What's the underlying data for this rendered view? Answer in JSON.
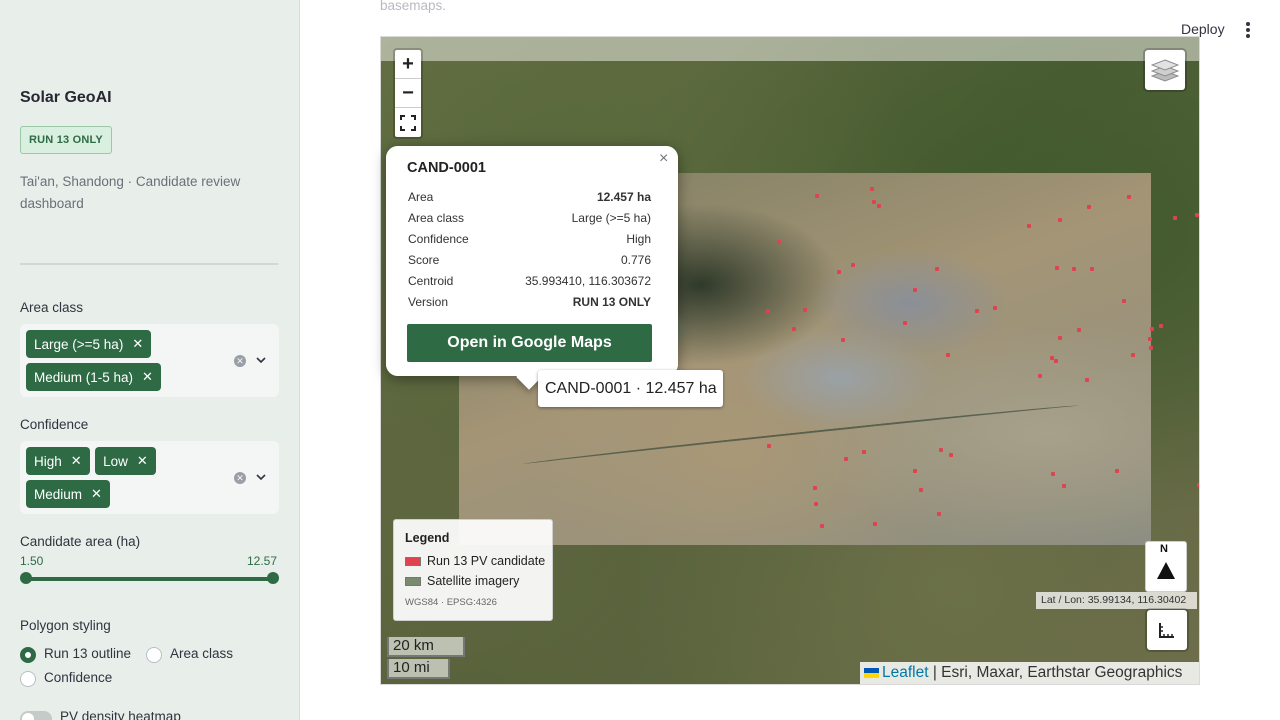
{
  "sidebar": {
    "title": "Solar GeoAI",
    "badge": "RUN 13 ONLY",
    "subtitle": "Tai'an, Shandong · Candidate review dashboard",
    "area_class": {
      "label": "Area class",
      "chips": [
        "Large (>=5 ha)",
        "Medium (1-5 ha)"
      ]
    },
    "confidence": {
      "label": "Confidence",
      "chips": [
        "High",
        "Low",
        "Medium"
      ]
    },
    "candidate_area": {
      "label": "Candidate area (ha)",
      "min": "1.50",
      "max": "12.57"
    },
    "polygon_styling": {
      "label": "Polygon styling",
      "options": [
        "Run 13 outline",
        "Area class",
        "Confidence"
      ],
      "selected": "Run 13 outline"
    },
    "heatmap_toggle": {
      "label": "PV density heatmap",
      "enabled": false
    }
  },
  "header": {
    "top_text": "basemaps.",
    "deploy_label": "Deploy"
  },
  "map": {
    "zoom_in": "+",
    "zoom_out": "−",
    "popup": {
      "title": "CAND-0001",
      "close": "×",
      "rows": [
        {
          "label": "Area",
          "value": "12.457 ha"
        },
        {
          "label": "Area class",
          "value": "Large (>=5 ha)"
        },
        {
          "label": "Confidence",
          "value": "High"
        },
        {
          "label": "Score",
          "value": "0.776"
        },
        {
          "label": "Centroid",
          "value": "35.993410, 116.303672"
        },
        {
          "label": "Version",
          "value": "RUN 13 ONLY"
        }
      ],
      "button": "Open in Google Maps"
    },
    "tooltip": "CAND-0001 · 12.457 ha",
    "legend": {
      "title": "Legend",
      "items": [
        {
          "label": "Run 13 PV candidate",
          "color": "#e0424f"
        },
        {
          "label": "Satellite imagery",
          "color": "#7a8a6e"
        }
      ],
      "crs": "WGS84 · EPSG:4326"
    },
    "north_label": "N",
    "latlon": "Lat / Lon: 35.99134, 116.30402",
    "scale": {
      "km": "20 km",
      "mi": "10 mi"
    },
    "attribution": {
      "leaflet": "Leaflet",
      "sources": " | Esri, Maxar, Earthstar Geographics"
    }
  },
  "colors": {
    "accent": "#2e6b45",
    "candidate": "#e0424f"
  }
}
